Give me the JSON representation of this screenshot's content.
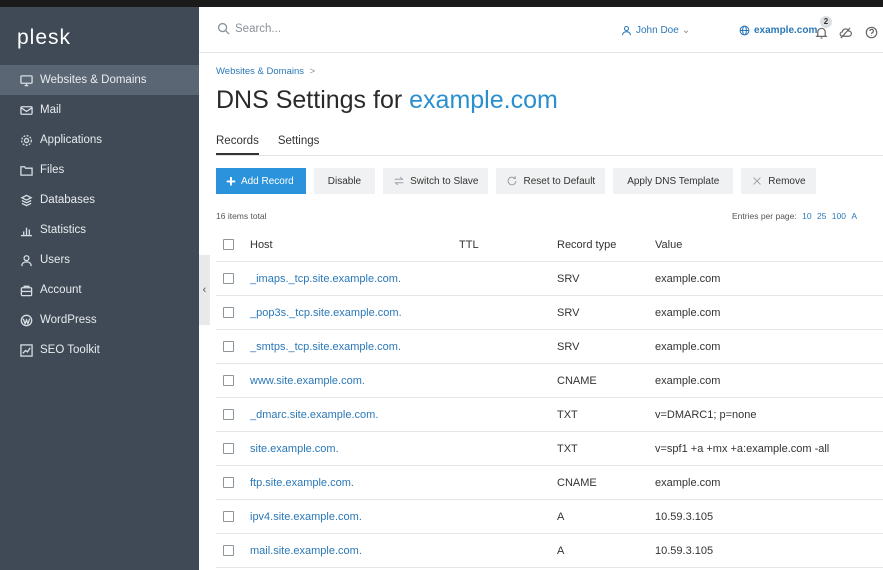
{
  "app": {
    "logo": "plesk"
  },
  "sidebar": {
    "items": [
      {
        "label": "Websites & Domains",
        "icon": "monitor-icon",
        "active": true
      },
      {
        "label": "Mail",
        "icon": "mail-icon",
        "active": false
      },
      {
        "label": "Applications",
        "icon": "gear-icon",
        "active": false
      },
      {
        "label": "Files",
        "icon": "folder-icon",
        "active": false
      },
      {
        "label": "Databases",
        "icon": "database-icon",
        "active": false
      },
      {
        "label": "Statistics",
        "icon": "bar-chart-icon",
        "active": false
      },
      {
        "label": "Users",
        "icon": "user-icon",
        "active": false
      },
      {
        "label": "Account",
        "icon": "account-icon",
        "active": false
      },
      {
        "label": "WordPress",
        "icon": "wordpress-icon",
        "active": false
      },
      {
        "label": "SEO Toolkit",
        "icon": "seo-chart-icon",
        "active": false
      }
    ],
    "collapse_glyph": "‹"
  },
  "header": {
    "search_placeholder": "Search...",
    "user_label": "John Doe",
    "user_caret": "⌄",
    "domain_label": "example.com",
    "notification_count": "2"
  },
  "breadcrumb": {
    "item": "Websites & Domains",
    "separator": ">"
  },
  "page": {
    "title_prefix": "DNS Settings for",
    "title_domain": "example.com"
  },
  "tabs": [
    {
      "label": "Records",
      "active": true
    },
    {
      "label": "Settings",
      "active": false
    }
  ],
  "toolbar": {
    "add_record": "Add Record",
    "disable": "Disable",
    "switch_to_slave": "Switch to Slave",
    "reset_to_default": "Reset to Default",
    "apply_dns_template": "Apply DNS Template",
    "remove": "Remove"
  },
  "list_info": {
    "total": "16 items total",
    "entries_label": "Entries per page:",
    "entries_options": [
      "10",
      "25",
      "100",
      "A"
    ]
  },
  "table": {
    "columns": {
      "host": "Host",
      "ttl": "TTL",
      "type": "Record type",
      "value": "Value"
    },
    "rows": [
      {
        "host": "_imaps._tcp.site.example.com.",
        "ttl": "",
        "type": "SRV",
        "value": "example.com"
      },
      {
        "host": "_pop3s._tcp.site.example.com.",
        "ttl": "",
        "type": "SRV",
        "value": "example.com"
      },
      {
        "host": "_smtps._tcp.site.example.com.",
        "ttl": "",
        "type": "SRV",
        "value": "example.com"
      },
      {
        "host": "www.site.example.com.",
        "ttl": "",
        "type": "CNAME",
        "value": "example.com"
      },
      {
        "host": "_dmarc.site.example.com.",
        "ttl": "",
        "type": "TXT",
        "value": "v=DMARC1; p=none"
      },
      {
        "host": "site.example.com.",
        "ttl": "",
        "type": "TXT",
        "value": "v=spf1 +a +mx +a:example.com -all"
      },
      {
        "host": "ftp.site.example.com.",
        "ttl": "",
        "type": "CNAME",
        "value": "example.com"
      },
      {
        "host": "ipv4.site.example.com.",
        "ttl": "",
        "type": "A",
        "value": "10.59.3.105"
      },
      {
        "host": "mail.site.example.com.",
        "ttl": "",
        "type": "A",
        "value": "10.59.3.105"
      }
    ]
  },
  "colors": {
    "sidebar_bg": "#3f4a56",
    "sidebar_active": "#5a6674",
    "link": "#2a78b8",
    "primary_button": "#2a93dc"
  }
}
